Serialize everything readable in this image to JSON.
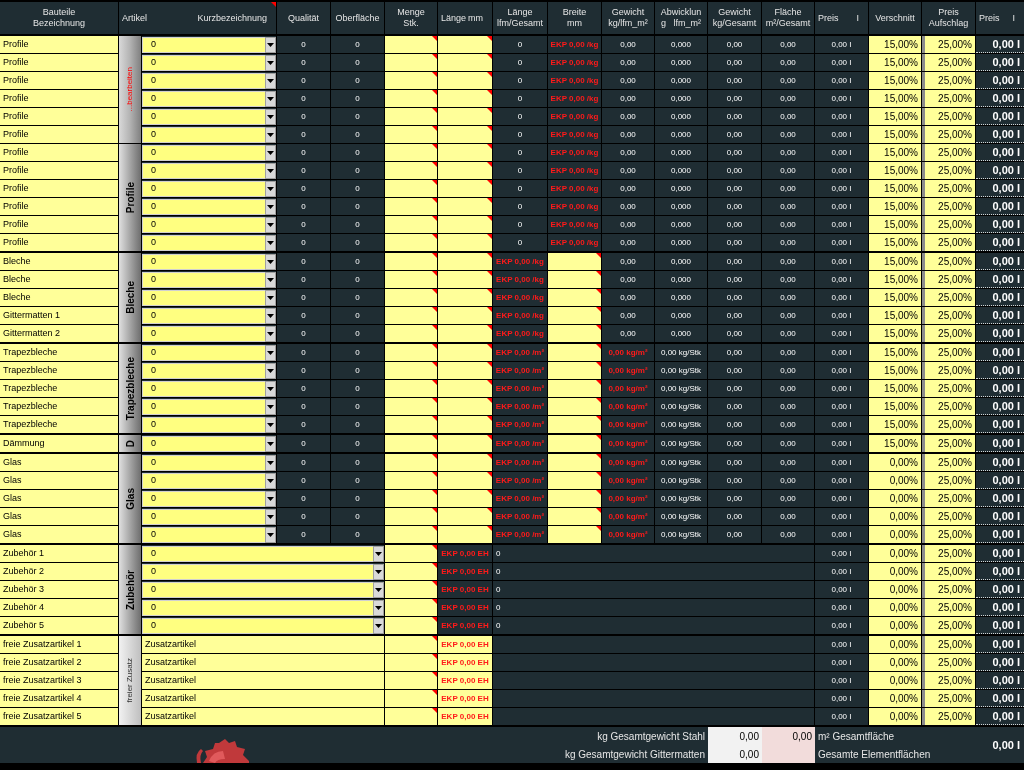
{
  "header": [
    {
      "kind": "lines",
      "lines": [
        "Bauteile",
        "Bezeichnung"
      ],
      "comment": false
    },
    {
      "kind": "pair",
      "left": "Artikel",
      "right": "Kurzbezeichnung",
      "comment": true
    },
    {
      "kind": "lines",
      "lines": [
        "Qualität"
      ],
      "comment": false
    },
    {
      "kind": "lines",
      "lines": [
        "Oberfläche"
      ],
      "comment": false
    },
    {
      "kind": "lines",
      "lines": [
        "Menge",
        "Stk."
      ],
      "comment": false
    },
    {
      "kind": "pair",
      "left": "Länge",
      "right": "mm",
      "comment": false
    },
    {
      "kind": "lines",
      "lines": [
        "Länge",
        "lfm/Gesamt"
      ],
      "comment": false
    },
    {
      "kind": "lines",
      "lines": [
        "Breite",
        "mm"
      ],
      "comment": false
    },
    {
      "kind": "lines",
      "lines": [
        "Gewicht",
        "kg/lfm_m²"
      ],
      "comment": false
    },
    {
      "kind": "lines",
      "lines": [
        "Abwicklun",
        "g   lfm_m²"
      ],
      "comment": false
    },
    {
      "kind": "lines",
      "lines": [
        "Gewicht",
        "kg/Gesamt"
      ],
      "comment": false
    },
    {
      "kind": "lines",
      "lines": [
        "Fläche",
        "m²/Gesamt"
      ],
      "comment": false
    },
    {
      "kind": "pair",
      "left": "Preis",
      "right": "I",
      "comment": false
    },
    {
      "kind": "lines",
      "lines": [
        "Verschnitt"
      ],
      "comment": false
    },
    {
      "kind": "lines",
      "lines": [
        "Preis",
        "Aufschlag"
      ],
      "comment": false
    },
    {
      "kind": "pair",
      "left": "Preis",
      "right": "I",
      "comment": false
    }
  ],
  "groups": [
    {
      "kind": "profile",
      "labels": [
        {
          "kind": "link",
          "text": "...bearbeiten"
        },
        {
          "kind": "title",
          "text": "Profile"
        }
      ],
      "rows": [
        {
          "name": "Profile",
          "article": "0",
          "cells": [
            "0",
            "0",
            "0",
            "EKP 0,00 /kg",
            "0,00",
            "0,000",
            "0,00",
            "0,00",
            "0,00 I",
            "15,00%",
            "25,00%",
            "0,00 I"
          ]
        },
        {
          "name": "Profile",
          "article": "0",
          "cells": [
            "0",
            "0",
            "0",
            "EKP 0,00 /kg",
            "0,00",
            "0,000",
            "0,00",
            "0,00",
            "0,00 I",
            "15,00%",
            "25,00%",
            "0,00 I"
          ]
        },
        {
          "name": "Profile",
          "article": "0",
          "cells": [
            "0",
            "0",
            "0",
            "EKP 0,00 /kg",
            "0,00",
            "0,000",
            "0,00",
            "0,00",
            "0,00 I",
            "15,00%",
            "25,00%",
            "0,00 I"
          ]
        },
        {
          "name": "Profile",
          "article": "0",
          "cells": [
            "0",
            "0",
            "0",
            "EKP 0,00 /kg",
            "0,00",
            "0,000",
            "0,00",
            "0,00",
            "0,00 I",
            "15,00%",
            "25,00%",
            "0,00 I"
          ]
        },
        {
          "name": "Profile",
          "article": "0",
          "cells": [
            "0",
            "0",
            "0",
            "EKP 0,00 /kg",
            "0,00",
            "0,000",
            "0,00",
            "0,00",
            "0,00 I",
            "15,00%",
            "25,00%",
            "0,00 I"
          ]
        },
        {
          "name": "Profile",
          "article": "0",
          "cells": [
            "0",
            "0",
            "0",
            "EKP 0,00 /kg",
            "0,00",
            "0,000",
            "0,00",
            "0,00",
            "0,00 I",
            "15,00%",
            "25,00%",
            "0,00 I"
          ]
        },
        {
          "name": "Profile",
          "article": "0",
          "cells": [
            "0",
            "0",
            "0",
            "EKP 0,00 /kg",
            "0,00",
            "0,000",
            "0,00",
            "0,00",
            "0,00 I",
            "15,00%",
            "25,00%",
            "0,00 I"
          ]
        },
        {
          "name": "Profile",
          "article": "0",
          "cells": [
            "0",
            "0",
            "0",
            "EKP 0,00 /kg",
            "0,00",
            "0,000",
            "0,00",
            "0,00",
            "0,00 I",
            "15,00%",
            "25,00%",
            "0,00 I"
          ]
        },
        {
          "name": "Profile",
          "article": "0",
          "cells": [
            "0",
            "0",
            "0",
            "EKP 0,00 /kg",
            "0,00",
            "0,000",
            "0,00",
            "0,00",
            "0,00 I",
            "15,00%",
            "25,00%",
            "0,00 I"
          ]
        },
        {
          "name": "Profile",
          "article": "0",
          "cells": [
            "0",
            "0",
            "0",
            "EKP 0,00 /kg",
            "0,00",
            "0,000",
            "0,00",
            "0,00",
            "0,00 I",
            "15,00%",
            "25,00%",
            "0,00 I"
          ]
        },
        {
          "name": "Profile",
          "article": "0",
          "cells": [
            "0",
            "0",
            "0",
            "EKP 0,00 /kg",
            "0,00",
            "0,000",
            "0,00",
            "0,00",
            "0,00 I",
            "15,00%",
            "25,00%",
            "0,00 I"
          ]
        },
        {
          "name": "Profile",
          "article": "0",
          "cells": [
            "0",
            "0",
            "0",
            "EKP 0,00 /kg",
            "0,00",
            "0,000",
            "0,00",
            "0,00",
            "0,00 I",
            "15,00%",
            "25,00%",
            "0,00 I"
          ]
        }
      ]
    },
    {
      "kind": "sheet",
      "labels": [
        {
          "kind": "title",
          "text": "Bleche"
        }
      ],
      "rows": [
        {
          "name": "Bleche",
          "article": "0",
          "cells": [
            "0",
            "0",
            "EKP 0,00 /kg",
            "0,00",
            "0,000",
            "0,00",
            "0,00",
            "0,00 I",
            "15,00%",
            "25,00%",
            "0,00 I"
          ]
        },
        {
          "name": "Bleche",
          "article": "0",
          "cells": [
            "0",
            "0",
            "EKP 0,00 /kg",
            "0,00",
            "0,000",
            "0,00",
            "0,00",
            "0,00 I",
            "15,00%",
            "25,00%",
            "0,00 I"
          ]
        },
        {
          "name": "Bleche",
          "article": "0",
          "cells": [
            "0",
            "0",
            "EKP 0,00 /kg",
            "0,00",
            "0,000",
            "0,00",
            "0,00",
            "0,00 I",
            "15,00%",
            "25,00%",
            "0,00 I"
          ]
        },
        {
          "name": "Gittermatten 1",
          "article": "0",
          "cells": [
            "0",
            "0",
            "EKP 0,00 /kg",
            "0,00",
            "0,000",
            "0,00",
            "0,00",
            "0,00 I",
            "15,00%",
            "25,00%",
            "0,00 I"
          ]
        },
        {
          "name": "Gittermatten 2",
          "article": "0",
          "cells": [
            "0",
            "0",
            "EKP 0,00 /kg",
            "0,00",
            "0,000",
            "0,00",
            "0,00",
            "0,00 I",
            "15,00%",
            "25,00%",
            "0,00 I"
          ]
        }
      ]
    },
    {
      "kind": "trapez",
      "labels": [
        {
          "kind": "title",
          "text": "Trapezbleche"
        }
      ],
      "rows": [
        {
          "name": "Trapezbleche",
          "article": "0",
          "cells": [
            "0",
            "0",
            "EKP 0,00 /m²",
            "0,00 kg/m²",
            "0,00 kg/Stk",
            "0,00",
            "0,00",
            "0,00 I",
            "15,00%",
            "25,00%",
            "0,00 I"
          ]
        },
        {
          "name": "Trapezbleche",
          "article": "0",
          "cells": [
            "0",
            "0",
            "EKP 0,00 /m²",
            "0,00 kg/m²",
            "0,00 kg/Stk",
            "0,00",
            "0,00",
            "0,00 I",
            "15,00%",
            "25,00%",
            "0,00 I"
          ]
        },
        {
          "name": "Trapezbleche",
          "article": "0",
          "cells": [
            "0",
            "0",
            "EKP 0,00 /m²",
            "0,00 kg/m²",
            "0,00 kg/Stk",
            "0,00",
            "0,00",
            "0,00 I",
            "15,00%",
            "25,00%",
            "0,00 I"
          ]
        },
        {
          "name": "Trapezbleche",
          "article": "0",
          "cells": [
            "0",
            "0",
            "EKP 0,00 /m²",
            "0,00 kg/m²",
            "0,00 kg/Stk",
            "0,00",
            "0,00",
            "0,00 I",
            "15,00%",
            "25,00%",
            "0,00 I"
          ]
        },
        {
          "name": "Trapezbleche",
          "article": "0",
          "cells": [
            "0",
            "0",
            "EKP 0,00 /m²",
            "0,00 kg/m²",
            "0,00 kg/Stk",
            "0,00",
            "0,00",
            "0,00 I",
            "15,00%",
            "25,00%",
            "0,00 I"
          ]
        }
      ]
    },
    {
      "kind": "trapez",
      "labels": [
        {
          "kind": "title",
          "text": "D"
        }
      ],
      "rows": [
        {
          "name": "Dämmung",
          "article": "0",
          "cells": [
            "0",
            "0",
            "EKP 0,00 /m²",
            "0,00 kg/m²",
            "0,00 kg/Stk",
            "0,00",
            "0,00",
            "0,00 I",
            "15,00%",
            "25,00%",
            "0,00 I"
          ]
        }
      ]
    },
    {
      "kind": "trapez",
      "labels": [
        {
          "kind": "title",
          "text": "Glas"
        }
      ],
      "rows": [
        {
          "name": "Glas",
          "article": "0",
          "cells": [
            "0",
            "0",
            "EKP 0,00 /m²",
            "0,00 kg/m²",
            "0,00 kg/Stk",
            "0,00",
            "0,00",
            "0,00 I",
            "0,00%",
            "25,00%",
            "0,00 I"
          ]
        },
        {
          "name": "Glas",
          "article": "0",
          "cells": [
            "0",
            "0",
            "EKP 0,00 /m²",
            "0,00 kg/m²",
            "0,00 kg/Stk",
            "0,00",
            "0,00",
            "0,00 I",
            "0,00%",
            "25,00%",
            "0,00 I"
          ]
        },
        {
          "name": "Glas",
          "article": "0",
          "cells": [
            "0",
            "0",
            "EKP 0,00 /m²",
            "0,00 kg/m²",
            "0,00 kg/Stk",
            "0,00",
            "0,00",
            "0,00 I",
            "0,00%",
            "25,00%",
            "0,00 I"
          ]
        },
        {
          "name": "Glas",
          "article": "0",
          "cells": [
            "0",
            "0",
            "EKP 0,00 /m²",
            "0,00 kg/m²",
            "0,00 kg/Stk",
            "0,00",
            "0,00",
            "0,00 I",
            "0,00%",
            "25,00%",
            "0,00 I"
          ]
        },
        {
          "name": "Glas",
          "article": "0",
          "cells": [
            "0",
            "0",
            "EKP 0,00 /m²",
            "0,00 kg/m²",
            "0,00 kg/Stk",
            "0,00",
            "0,00",
            "0,00 I",
            "0,00%",
            "25,00%",
            "0,00 I"
          ]
        }
      ]
    },
    {
      "kind": "accessory",
      "labels": [
        {
          "kind": "title",
          "text": "Zubehör"
        }
      ],
      "rows": [
        {
          "name": "Zubehör 1",
          "article": "0",
          "cells": [
            "EKP 0,00 EH",
            "0",
            "0,00 I",
            "0,00%",
            "25,00%",
            "0,00 I"
          ]
        },
        {
          "name": "Zubehör 2",
          "article": "0",
          "cells": [
            "EKP 0,00 EH",
            "0",
            "0,00 I",
            "0,00%",
            "25,00%",
            "0,00 I"
          ]
        },
        {
          "name": "Zubehör 3",
          "article": "0",
          "cells": [
            "EKP 0,00 EH",
            "0",
            "0,00 I",
            "0,00%",
            "25,00%",
            "0,00 I"
          ]
        },
        {
          "name": "Zubehör 4",
          "article": "0",
          "cells": [
            "EKP 0,00 EH",
            "0",
            "0,00 I",
            "0,00%",
            "25,00%",
            "0,00 I"
          ]
        },
        {
          "name": "Zubehör 5",
          "article": "0",
          "cells": [
            "EKP 0,00 EH",
            "0",
            "0,00 I",
            "0,00%",
            "25,00%",
            "0,00 I"
          ]
        }
      ]
    },
    {
      "kind": "free",
      "labels": [
        {
          "kind": "plain",
          "text": "freier Zusatz"
        }
      ],
      "rows": [
        {
          "name": "freie Zusatzartikel 1",
          "article": "Zusatzartikel",
          "cells": [
            "EKP 0,00 EH",
            "0,00 I",
            "0,00%",
            "25,00%",
            "0,00 I"
          ]
        },
        {
          "name": "freie Zusatzartikel 2",
          "article": "Zusatzartikel",
          "cells": [
            "EKP 0,00 EH",
            "0,00 I",
            "0,00%",
            "25,00%",
            "0,00 I"
          ]
        },
        {
          "name": "freie Zusatzartikel 3",
          "article": "Zusatzartikel",
          "cells": [
            "EKP 0,00 EH",
            "0,00 I",
            "0,00%",
            "25,00%",
            "0,00 I"
          ]
        },
        {
          "name": "freie Zusatzartikel 4",
          "article": "Zusatzartikel",
          "cells": [
            "EKP 0,00 EH",
            "0,00 I",
            "0,00%",
            "25,00%",
            "0,00 I"
          ]
        },
        {
          "name": "freie Zusatzartikel 5",
          "article": "Zusatzartikel",
          "cells": [
            "EKP 0,00 EH",
            "0,00 I",
            "0,00%",
            "25,00%",
            "0,00 I"
          ]
        }
      ]
    }
  ],
  "footer": {
    "rows": [
      {
        "label": "kg Gesamtgewicht Stahl",
        "value": "0,00",
        "value_2": "0,00",
        "caption": "m² Gesamtfläche"
      },
      {
        "label": "kg Gesamtgewicht Gittermatten",
        "value": "0,00",
        "caption": "Gesamte Elementflächen"
      }
    ],
    "total": "0,00 I"
  }
}
